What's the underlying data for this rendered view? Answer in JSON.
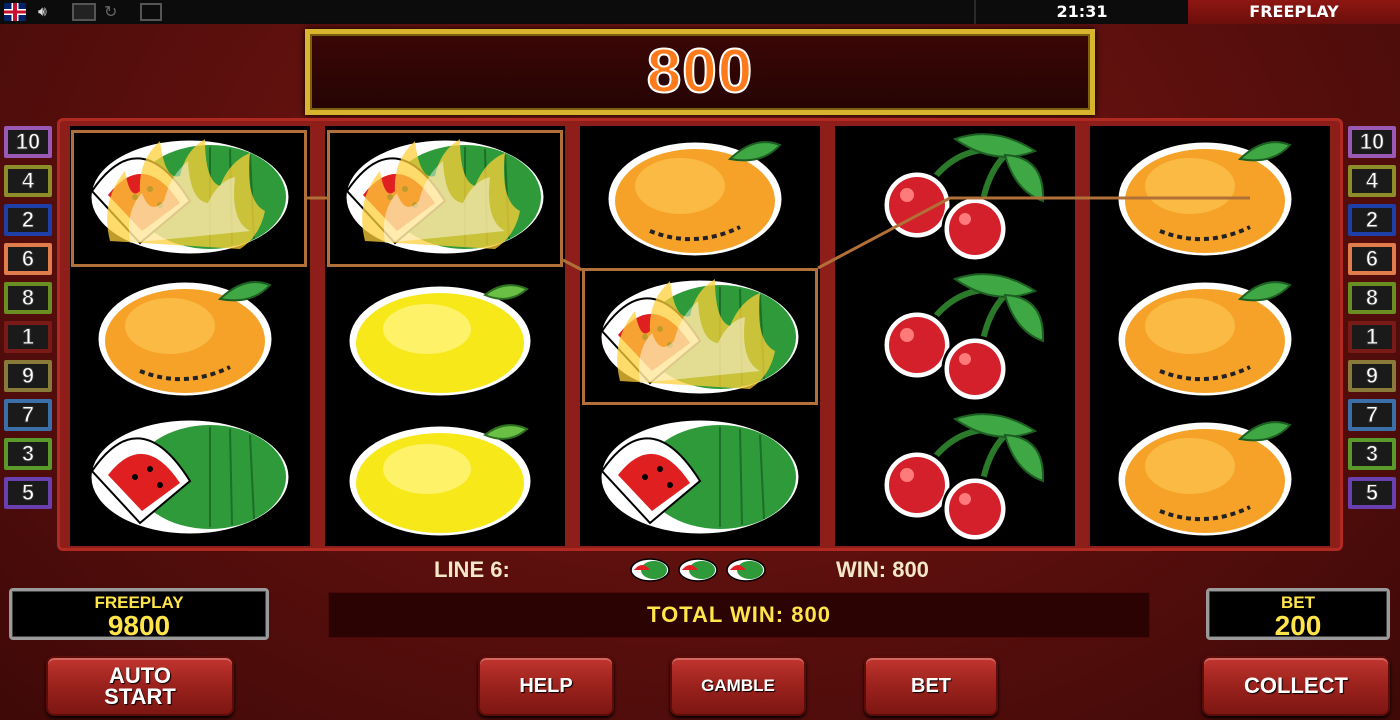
{
  "top_bar": {
    "icons": [
      "uk-flag-icon",
      "speaker-icon",
      "square-icon",
      "refresh-icon",
      "fullscreen-icon"
    ],
    "clock": "21:31",
    "mode": "FREEPLAY"
  },
  "win_display": {
    "value": "800"
  },
  "lines_left": [
    {
      "num": "10",
      "color": "#9b59b6"
    },
    {
      "num": "4",
      "color": "#8d8d2a"
    },
    {
      "num": "2",
      "color": "#1f3fa8"
    },
    {
      "num": "6",
      "color": "#e07d4a"
    },
    {
      "num": "8",
      "color": "#6b8e23"
    },
    {
      "num": "1",
      "color": "#7a1a16"
    },
    {
      "num": "9",
      "color": "#8a7a3a"
    },
    {
      "num": "7",
      "color": "#3b6fa8"
    },
    {
      "num": "3",
      "color": "#5a9a2a"
    },
    {
      "num": "5",
      "color": "#6a3fb0"
    }
  ],
  "lines_right": [
    {
      "num": "10",
      "color": "#9b59b6"
    },
    {
      "num": "4",
      "color": "#8d8d2a"
    },
    {
      "num": "2",
      "color": "#1f3fa8"
    },
    {
      "num": "6",
      "color": "#e07d4a"
    },
    {
      "num": "8",
      "color": "#6b8e23"
    },
    {
      "num": "1",
      "color": "#7a1a16"
    },
    {
      "num": "9",
      "color": "#8a7a3a"
    },
    {
      "num": "7",
      "color": "#3b6fa8"
    },
    {
      "num": "3",
      "color": "#5a9a2a"
    },
    {
      "num": "5",
      "color": "#6a3fb0"
    }
  ],
  "reels": [
    [
      "watermelon-burning",
      "orange",
      "watermelon"
    ],
    [
      "watermelon-burning",
      "lemon",
      "lemon"
    ],
    [
      "orange",
      "watermelon-burning",
      "watermelon"
    ],
    [
      "cherry",
      "cherry",
      "cherry"
    ],
    [
      "orange",
      "orange",
      "orange"
    ]
  ],
  "line_info": {
    "line": "LINE 6:",
    "win": "WIN: 800"
  },
  "total_win": "TOTAL WIN: 800",
  "credit": {
    "label": "FREEPLAY",
    "value": "9800"
  },
  "bet": {
    "label": "BET",
    "value": "200"
  },
  "buttons": {
    "auto_start_1": "AUTO",
    "auto_start_2": "START",
    "help": "HELP",
    "gamble": "GAMBLE",
    "bet": "BET",
    "collect": "COLLECT"
  },
  "colors": {
    "win_frame": "#d9b52f",
    "highlight": "#b07038",
    "yellow_text": "#ffe44a"
  }
}
